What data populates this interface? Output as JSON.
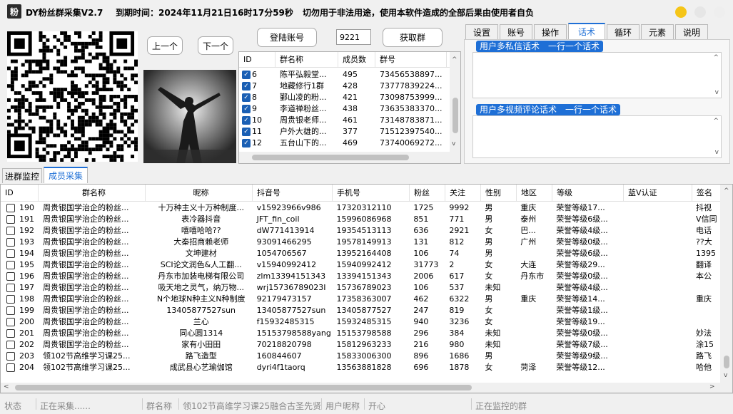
{
  "window": {
    "app_icon": "粉",
    "title": "DY粉丝群采集V2.7",
    "expiry": "到期时间：2024年11月21日16时17分59秒",
    "warning": "切勿用于非法用途，使用本软件造成的全部后果由使用者自负",
    "colors": {
      "min": "#f5c518",
      "max": "#e6e6e6",
      "close": "#eeeeee"
    }
  },
  "controls": {
    "prev_label": "上一个",
    "next_label": "下一个",
    "login_label": "登陆账号",
    "group_count_value": "9221",
    "get_group_label": "获取群"
  },
  "group_table": {
    "headers": [
      "ID",
      "群名称",
      "成员数",
      "群号"
    ],
    "rows": [
      {
        "checked": true,
        "id": "6",
        "name": "陈平弘毅堂...",
        "members": "495",
        "no": "73456538897..."
      },
      {
        "checked": true,
        "id": "7",
        "name": "地藏修行1群",
        "members": "428",
        "no": "73777839224..."
      },
      {
        "checked": true,
        "id": "8",
        "name": "鄞山凌的粉...",
        "members": "421",
        "no": "73098753999..."
      },
      {
        "checked": true,
        "id": "9",
        "name": "李道禅粉丝...",
        "members": "438",
        "no": "73635383370..."
      },
      {
        "checked": true,
        "id": "10",
        "name": "周贵银老师...",
        "members": "461",
        "no": "73148783871..."
      },
      {
        "checked": true,
        "id": "11",
        "name": "户外大雄的...",
        "members": "377",
        "no": "71512397540..."
      },
      {
        "checked": true,
        "id": "12",
        "name": "五台山下的...",
        "members": "469",
        "no": "73740069272..."
      }
    ]
  },
  "right_tabs": [
    "设置",
    "账号",
    "操作",
    "话术",
    "循环",
    "元素",
    "说明"
  ],
  "right_active_tab": 3,
  "scripts": {
    "private_label": "用户多私信话术　一行一个话术",
    "comment_label": "用户多视频评论话术　一行一个话术"
  },
  "lower_tabs": [
    "进群监控",
    "成员采集"
  ],
  "lower_active_tab": 1,
  "member_table": {
    "headers": [
      "ID",
      "群名称",
      "昵称",
      "抖音号",
      "手机号",
      "粉丝",
      "关注",
      "性别",
      "地区",
      "等级",
      "蓝V认证",
      "签名"
    ],
    "rows": [
      [
        "190",
        "周贵银国学治企的粉丝...",
        "十万种主义十万种制度...",
        "v15923966v986",
        "17320312110",
        "1725",
        "9992",
        "男",
        "重庆",
        "荣誉等级17...",
        "",
        "抖视"
      ],
      [
        "191",
        "周贵银国学治企的粉丝...",
        "表冷器抖音",
        "JFT_fin_coil",
        "15996086968",
        "851",
        "771",
        "男",
        "泰州",
        "荣誉等级6级...",
        "",
        "V信同"
      ],
      [
        "192",
        "周贵银国学治企的粉丝...",
        "嘻嘻哈哈??",
        "dW771413914",
        "19354513113",
        "636",
        "2921",
        "女",
        "巴...",
        "荣誉等级4级...",
        "",
        "电话"
      ],
      [
        "193",
        "周贵银国学治企的粉丝...",
        "大秦招商赖老师",
        "93091466295",
        "19578149913",
        "131",
        "812",
        "男",
        "广州",
        "荣誉等级0级...",
        "",
        "??大"
      ],
      [
        "194",
        "周贵银国学治企的粉丝...",
        "文坤建材",
        "1054706567",
        "13952164408",
        "106",
        "74",
        "男",
        "",
        "荣誉等级6级...",
        "",
        "1395"
      ],
      [
        "195",
        "周贵银国学治企的粉丝...",
        "SCI论文润色&人工翻...",
        "v15940992412",
        "15940992412",
        "31773",
        "2",
        "女",
        "大连",
        "荣誉等级29...",
        "",
        "翻译"
      ],
      [
        "196",
        "周贵银国学治企的粉丝...",
        "丹东市加装电梯有限公司",
        "zlm13394151343",
        "13394151343",
        "2006",
        "617",
        "女",
        "丹东市",
        "荣誉等级0级...",
        "",
        "本公"
      ],
      [
        "197",
        "周贵银国学治企的粉丝...",
        "吸天地之灵气，纳万物...",
        "wrj15736789023I",
        "15736789023",
        "106",
        "537",
        "未知",
        "",
        "荣誉等级4级...",
        "",
        ""
      ],
      [
        "198",
        "周贵银国学治企的粉丝...",
        "N个地球N种主义N种制度",
        "92179473157",
        "17358363007",
        "462",
        "6322",
        "男",
        "重庆",
        "荣誉等级14...",
        "",
        "重庆"
      ],
      [
        "199",
        "周贵银国学治企的粉丝...",
        "13405877527sun",
        "13405877527sun",
        "13405877527",
        "247",
        "819",
        "女",
        "",
        "荣誉等级1级...",
        "",
        ""
      ],
      [
        "200",
        "周贵银国学治企的粉丝...",
        "兰心",
        "f15932485315",
        "15932485315",
        "940",
        "3236",
        "女",
        "",
        "荣誉等级19...",
        "",
        ""
      ],
      [
        "201",
        "周贵银国学治企的粉丝...",
        "同心圆1314",
        "15153798588yang",
        "15153798588",
        "296",
        "384",
        "未知",
        "",
        "荣誉等级0级...",
        "",
        "妙法"
      ],
      [
        "202",
        "周贵银国学治企的粉丝...",
        "家有小田田",
        "70218820798",
        "15812963233",
        "216",
        "980",
        "未知",
        "",
        "荣誉等级7级...",
        "",
        "涂15"
      ],
      [
        "203",
        "领102节高维学习课25...",
        "路飞造型",
        "160844607",
        "15833006300",
        "896",
        "1686",
        "男",
        "",
        "荣誉等级9级...",
        "",
        "路飞"
      ],
      [
        "204",
        "领102节高维学习课25...",
        "成武县心艺瑜伽馆",
        "dyri4f1taorq",
        "13563881828",
        "696",
        "1878",
        "女",
        "菏泽",
        "荣誉等级12...",
        "",
        "哈他"
      ]
    ]
  },
  "status": {
    "label": "状态",
    "value": "正在采集......",
    "group_label": "群名称",
    "group_value": "领102节高维学习课25融合古圣先贤",
    "nick_label": "用户昵称",
    "nick_value": "开心",
    "monitor": "正在监控的群"
  }
}
